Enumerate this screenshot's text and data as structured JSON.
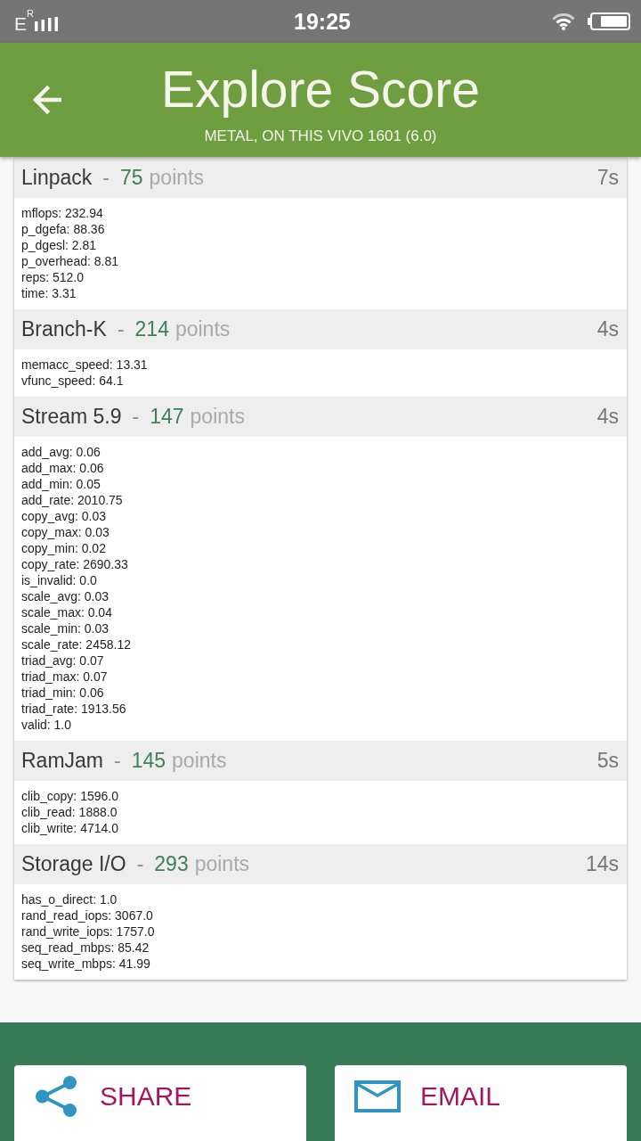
{
  "status_bar": {
    "network_type": "E",
    "roaming_mark": "R",
    "time": "19:25"
  },
  "app_bar": {
    "title": "Explore Score",
    "subtitle": "METAL, ON THIS VIVO 1601 (6.0)"
  },
  "results": [
    {
      "name": "Linpack",
      "separator": "-",
      "score": "75",
      "unit": "points",
      "duration": "7s",
      "metrics": [
        "mflops: 232.94",
        "p_dgefa: 88.36",
        "p_dgesl: 2.81",
        "p_overhead: 8.81",
        "reps: 512.0",
        "time: 3.31"
      ]
    },
    {
      "name": "Branch-K",
      "separator": "-",
      "score": "214",
      "unit": "points",
      "duration": "4s",
      "metrics": [
        "memacc_speed: 13.31",
        "vfunc_speed: 64.1"
      ]
    },
    {
      "name": "Stream 5.9",
      "separator": "-",
      "score": "147",
      "unit": "points",
      "duration": "4s",
      "metrics": [
        "add_avg: 0.06",
        "add_max: 0.06",
        "add_min: 0.05",
        "add_rate: 2010.75",
        "copy_avg: 0.03",
        "copy_max: 0.03",
        "copy_min: 0.02",
        "copy_rate: 2690.33",
        "is_invalid: 0.0",
        "scale_avg: 0.03",
        "scale_max: 0.04",
        "scale_min: 0.03",
        "scale_rate: 2458.12",
        "triad_avg: 0.07",
        "triad_max: 0.07",
        "triad_min: 0.06",
        "triad_rate: 1913.56",
        "valid: 1.0"
      ]
    },
    {
      "name": "RamJam",
      "separator": "-",
      "score": "145",
      "unit": "points",
      "duration": "5s",
      "metrics": [
        "clib_copy: 1596.0",
        "clib_read: 1888.0",
        "clib_write: 4714.0"
      ]
    },
    {
      "name": "Storage I/O",
      "separator": "-",
      "score": "293",
      "unit": "points",
      "duration": "14s",
      "metrics": [
        "has_o_direct: 1.0",
        "rand_read_iops: 3067.0",
        "rand_write_iops: 1757.0",
        "seq_read_mbps: 85.42",
        "seq_write_mbps: 41.99"
      ]
    }
  ],
  "actions": [
    {
      "kind": "share",
      "label": "SHARE"
    },
    {
      "kind": "email",
      "label": "EMAIL"
    }
  ]
}
